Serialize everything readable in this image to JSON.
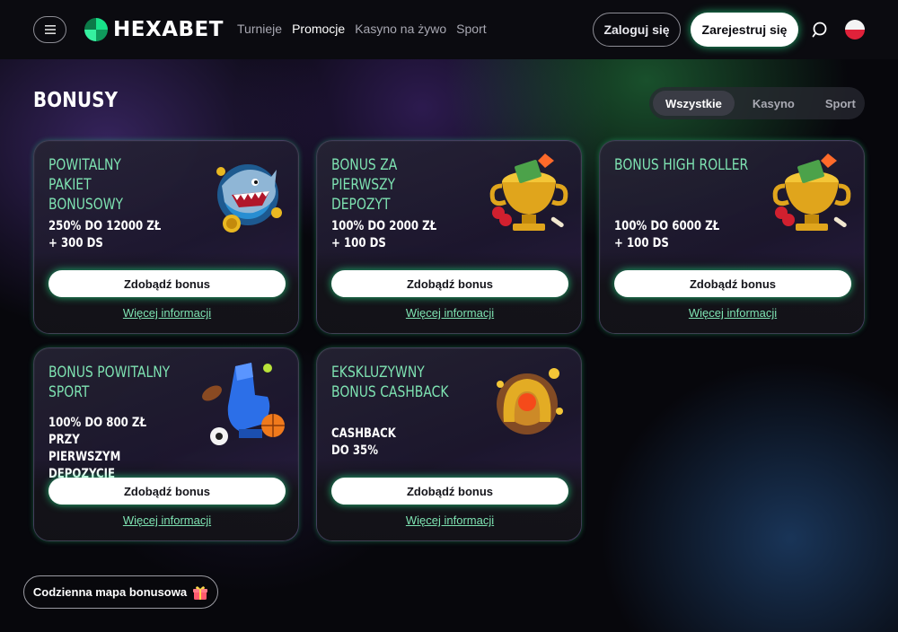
{
  "brand": {
    "name": "HEXABET"
  },
  "header": {
    "menu_icon": "hamburger-icon",
    "nav": [
      "Turnieje",
      "Promocje",
      "Kasyno na żywo",
      "Sport"
    ],
    "active_nav": "Promocje",
    "login_label": "Zaloguj się",
    "register_label": "Zarejestruj się",
    "search_icon": "search-icon",
    "language_icon": "flag-pl-icon"
  },
  "page": {
    "title": "BONUSY",
    "filters": [
      "Wszystkie",
      "Kasyno",
      "Sport"
    ],
    "active_filter": "Wszystkie"
  },
  "cards": [
    {
      "title": "POWITALNY PAKIET BONUSOWY",
      "desc": "250% DO 12000 ZŁ + 300 DS",
      "button": "Zdobądź bonus",
      "link": "Więcej informacji",
      "art": "shark-icon"
    },
    {
      "title": "BONUS ZA PIERWSZY DEPOZYT",
      "desc": "100% DO 2000 ZŁ + 100 DS",
      "button": "Zdobądź bonus",
      "link": "Więcej informacji",
      "art": "trophy-icon"
    },
    {
      "title": "BONUS HIGH ROLLER",
      "desc": "100% DO 6000 ZŁ + 100 DS",
      "button": "Zdobądź bonus",
      "link": "Więcej informacji",
      "art": "trophy-icon"
    },
    {
      "title": "BONUS POWITALNY SPORT",
      "desc": "100% DO 800 ZŁ PRZY PIERWSZYM DEPOZYCIE",
      "button": "Zdobądź bonus",
      "link": "Więcej informacji",
      "art": "foam-finger-icon"
    },
    {
      "title": "EKSKLUZYWNY BONUS CASHBACK",
      "desc": "CASHBACK DO 35%",
      "button": "Zdobądź bonus",
      "link": "Więcej informacji",
      "art": "horseshoe-icon"
    }
  ],
  "daily_map": {
    "label": "Codzienna mapa bonusowa",
    "icon": "gift-icon"
  },
  "colors": {
    "accent_green": "#7ee3b2",
    "glow_green": "#28e68c",
    "background": "#07070c",
    "header": "#0b0b10"
  }
}
